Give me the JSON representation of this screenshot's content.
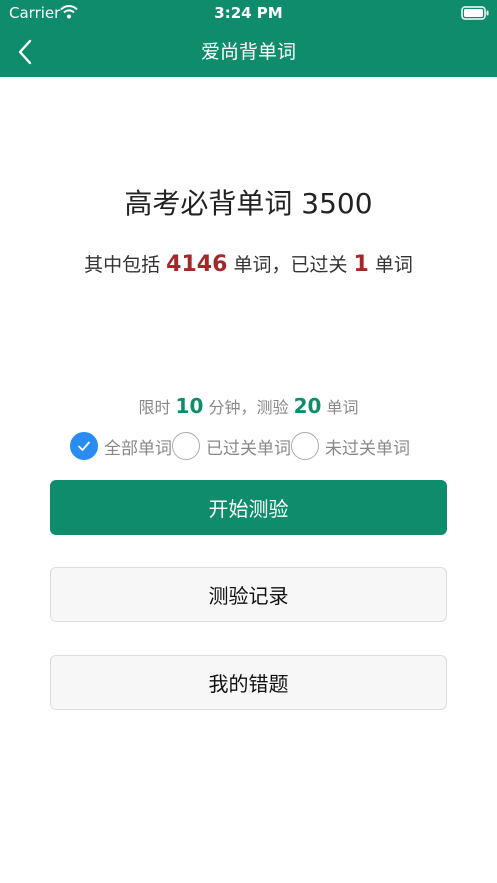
{
  "status_bar": {
    "carrier": "Carrier",
    "time": "3:24 PM"
  },
  "nav": {
    "title": "爱尚背单词"
  },
  "book": {
    "title": "高考必背单词 3500",
    "count_prefix": "其中包括",
    "total_words": "4146",
    "count_middle": "单词，已过关",
    "passed_words": "1",
    "count_suffix": "单词"
  },
  "quiz": {
    "limit_prefix": "限时",
    "minutes": "10",
    "limit_middle": "分钟，测验",
    "word_num": "20",
    "limit_suffix": "单词"
  },
  "filters": [
    {
      "label": "全部单词",
      "checked": true
    },
    {
      "label": "已过关单词",
      "checked": false
    },
    {
      "label": "未过关单词",
      "checked": false
    }
  ],
  "buttons": {
    "start": "开始测验",
    "records": "测验记录",
    "mistakes": "我的错题"
  },
  "colors": {
    "primary": "#0e8c6b",
    "highlight_red": "#a3282a",
    "radio_checked": "#2a8cf3"
  },
  "icons": {
    "back": "chevron-left-icon",
    "wifi": "wifi-icon",
    "battery": "battery-icon",
    "check": "checkmark-icon"
  }
}
